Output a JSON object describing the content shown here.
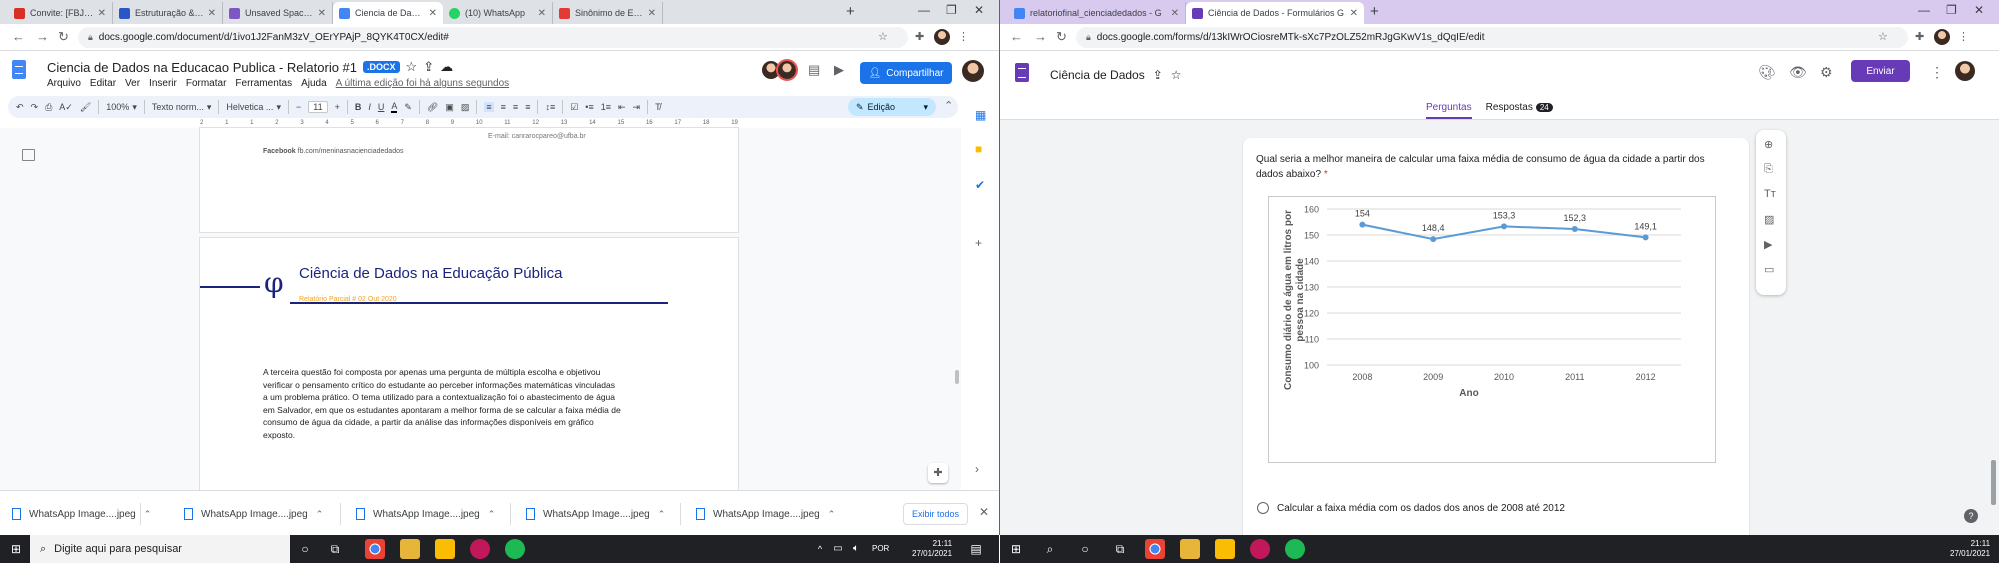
{
  "left": {
    "tabs": [
      {
        "title": "Convite: [FBJC] Reuniã",
        "color": "#d93025"
      },
      {
        "title": "Estruturação & Planeja",
        "color": "#2a56c6"
      },
      {
        "title": "Unsaved Space | Storie",
        "color": "#7e57c2"
      },
      {
        "title": "Ciencia de Dados na Ed",
        "color": "#4285f4"
      },
      {
        "title": "(10) WhatsApp",
        "color": "#25d366"
      },
      {
        "title": "Sinônimo de Espera - S",
        "color": "#e53935"
      }
    ],
    "url": "docs.google.com/document/d/1ivo1J2FanM3zV_OErYPAjP_8QYK4T0CX/edit#",
    "doc_title": "Ciencia de Dados na Educacao Publica - Relatorio #1",
    "badge": ".DOCX",
    "menus": [
      "Arquivo",
      "Editar",
      "Ver",
      "Inserir",
      "Formatar",
      "Ferramentas",
      "Ajuda"
    ],
    "last_edit": "A última edição foi há alguns segundos",
    "share": "Compartilhar",
    "toolbar": {
      "zoom": "100%",
      "style": "Texto norm...",
      "font": "Helvetica ...",
      "size": "11",
      "mode": "Edição"
    },
    "ruler": [
      "2",
      "1",
      "1",
      "2",
      "3",
      "4",
      "5",
      "6",
      "7",
      "8",
      "9",
      "10",
      "11",
      "12",
      "13",
      "14",
      "15",
      "16",
      "17",
      "18",
      "19"
    ],
    "page1": {
      "email": "E-mail: canrarocpareo@ufba.br",
      "fb_label": "Facebook",
      "fb_value": "fb.com/meninasnacienciadedados"
    },
    "page2": {
      "heading": "Ciência de Dados na Educação Pública",
      "subheading": "Relatório Parcial # 02 Out 2020",
      "phi": "φ",
      "lines": [
        "A terceira questão foi composta por apenas uma pergunta de múltipla escolha e objetivou",
        "verificar o pensamento crítico do estudante ao perceber informações matemáticas vinculadas",
        "a um problema prático. O tema utilizado para a contextualização foi o abastecimento de água",
        "em Salvador, em que os estudantes apontaram a melhor forma de se calcular a faixa média de",
        "consumo de água da cidade, a partir da análise das informações disponíveis em gráfico",
        "exposto."
      ]
    },
    "downloads": [
      "WhatsApp Image....jpeg",
      "WhatsApp Image....jpeg",
      "WhatsApp Image....jpeg",
      "WhatsApp Image....jpeg",
      "WhatsApp Image....jpeg"
    ],
    "show_all": "Exibir todos"
  },
  "right": {
    "tabs": [
      {
        "title": "relatoriofinal_cienciadedados - G",
        "color": "#4285f4"
      },
      {
        "title": "Ciência de Dados - Formulários G",
        "color": "#673ab7"
      }
    ],
    "url": "docs.google.com/forms/d/13kIWrOCiosreMTk-sXc7PzOLZ52mRJgGKwV1s_dQqIE/edit",
    "form_title": "Ciência de Dados",
    "send": "Enviar",
    "tab_questions": "Perguntas",
    "tab_responses": "Respostas",
    "responses_count": "24",
    "question": "Qual seria a melhor maneira de calcular uma faixa média de consumo de água da cidade a partir dos dados abaixo?",
    "required_mark": "*",
    "option1": "Calcular a faixa média com os dados dos anos de 2008 até 2012"
  },
  "chart_data": {
    "type": "line",
    "x": [
      "2008",
      "2009",
      "2010",
      "2011",
      "2012"
    ],
    "values": [
      154,
      148.4,
      153.3,
      152.3,
      149.1
    ],
    "data_labels": [
      "154",
      "148,4",
      "153,3",
      "152,3",
      "149,1"
    ],
    "xlabel": "Ano",
    "ylabel": "Consumo diário de água em litros por pessoa na cidade",
    "ylim": [
      100,
      160
    ],
    "yticks": [
      "100",
      "110",
      "120",
      "130",
      "140",
      "150",
      "160"
    ],
    "grid": true,
    "color": "#5b9bd5"
  },
  "taskbar": {
    "search_placeholder": "Digite aqui para pesquisar",
    "lang": "POR",
    "time": "21:11",
    "date": "27/01/2021"
  }
}
